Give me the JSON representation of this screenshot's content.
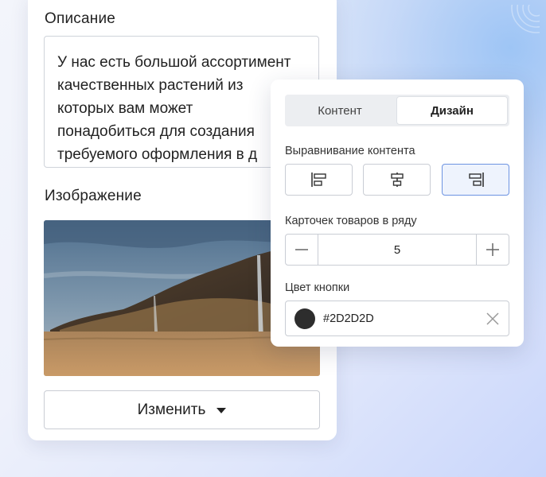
{
  "colors": {
    "border": "#c9cdd4",
    "active_border": "#6d93e2",
    "swatch": "#2D2D2D"
  },
  "editor": {
    "description_label": "Описание",
    "description_lines": [
      "У нас есть большой ассортимент",
      "качественных растений из",
      "которых вам может",
      "понадобиться для создания",
      "требуемого оформления в д"
    ],
    "image_label": "Изображение",
    "change_button": "Изменить"
  },
  "panel": {
    "tabs": [
      {
        "label": "Контент",
        "active": false
      },
      {
        "label": "Дизайн",
        "active": true
      }
    ],
    "alignment_label": "Выравнивание контента",
    "alignment_options": [
      {
        "icon": "align-left-icon",
        "active": false
      },
      {
        "icon": "align-center-icon",
        "active": false
      },
      {
        "icon": "align-right-icon",
        "active": true
      }
    ],
    "cards_label": "Карточек товаров в ряду",
    "cards_value": "5",
    "button_color_label": "Цвет кнопки",
    "button_color_value": "#2D2D2D"
  }
}
